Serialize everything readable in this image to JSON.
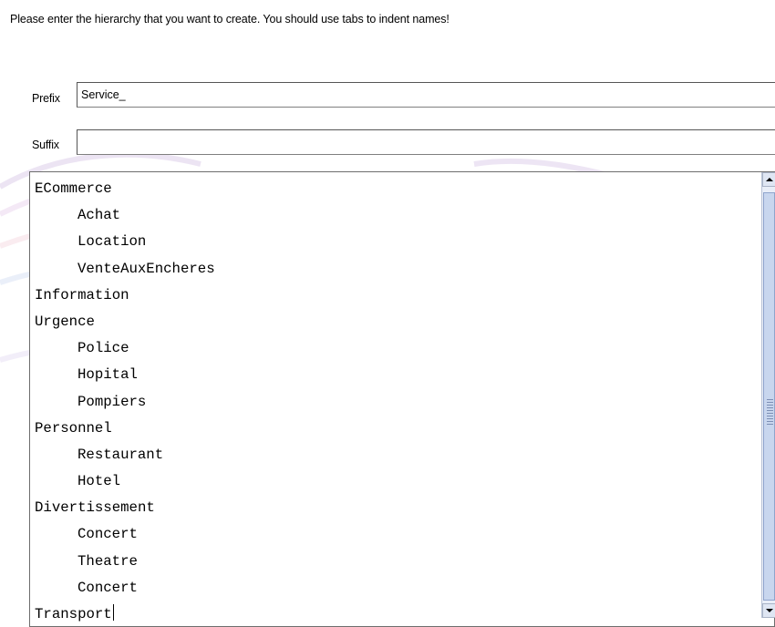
{
  "instruction": "Please enter the hierarchy that you want to create.  You should use tabs to indent names!",
  "prefix": {
    "label": "Prefix",
    "value": "Service_"
  },
  "suffix": {
    "label": "Suffix",
    "value": ""
  },
  "hierarchy_lines": [
    {
      "text": "ECommerce",
      "indent": 0
    },
    {
      "text": "Achat",
      "indent": 1
    },
    {
      "text": "Location",
      "indent": 1
    },
    {
      "text": "VenteAuxEncheres",
      "indent": 1
    },
    {
      "text": "Information",
      "indent": 0
    },
    {
      "text": "Urgence",
      "indent": 0
    },
    {
      "text": "Police",
      "indent": 1
    },
    {
      "text": "Hopital",
      "indent": 1
    },
    {
      "text": "Pompiers",
      "indent": 1
    },
    {
      "text": "Personnel",
      "indent": 0
    },
    {
      "text": "Restaurant",
      "indent": 1
    },
    {
      "text": "Hotel",
      "indent": 1
    },
    {
      "text": "Divertissement",
      "indent": 0
    },
    {
      "text": "Concert",
      "indent": 1
    },
    {
      "text": "Theatre",
      "indent": 1
    },
    {
      "text": "Concert",
      "indent": 1
    },
    {
      "text": "Transport",
      "indent": 0
    }
  ],
  "scrollbar_icons": {
    "up": "arrow-up-icon",
    "down": "arrow-down-icon"
  },
  "colors": {
    "scroll_track": "#e9eef8",
    "scroll_thumb": "#c8d6ee",
    "watermark": "#c9b9dd"
  }
}
